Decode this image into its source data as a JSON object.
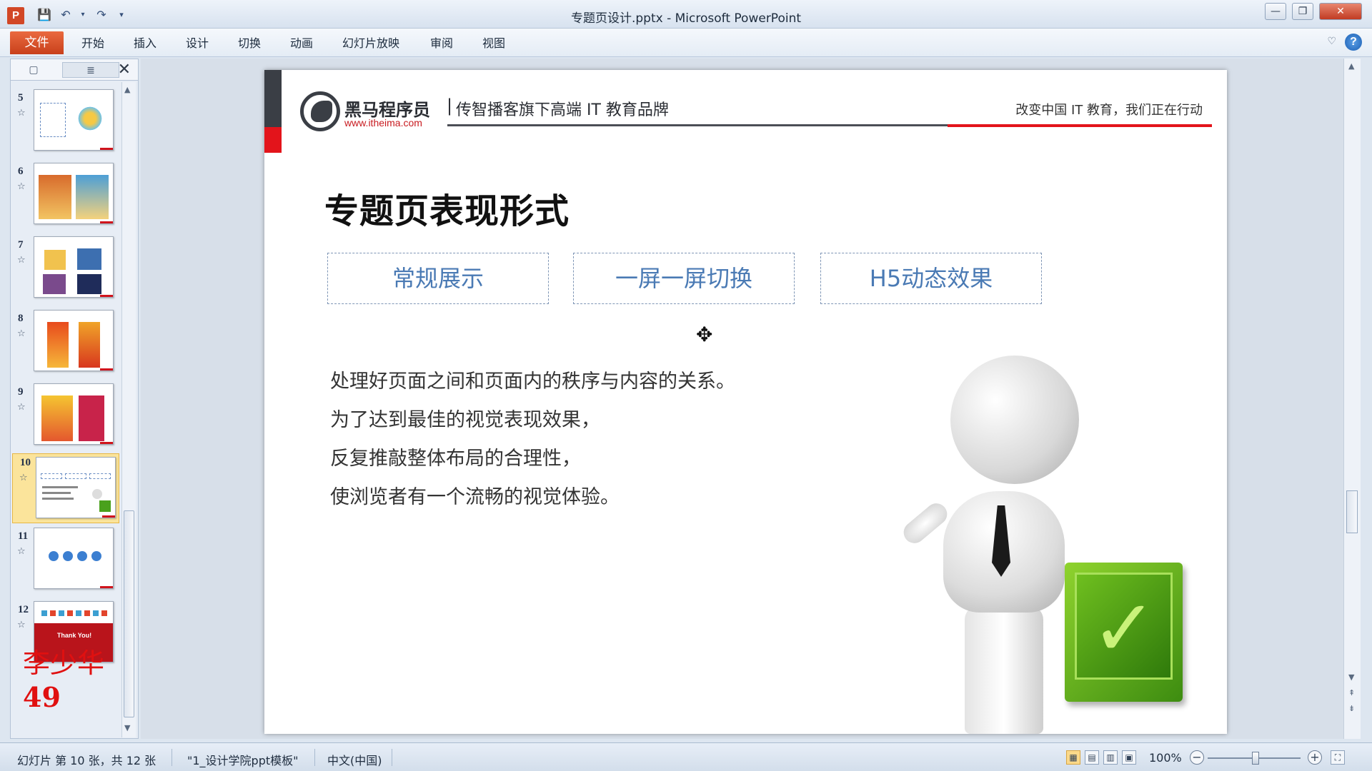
{
  "window": {
    "title": "专题页设计.pptx  -  Microsoft PowerPoint",
    "app_icon": "P"
  },
  "ribbon": {
    "file": "文件",
    "tabs": [
      "开始",
      "插入",
      "设计",
      "切换",
      "动画",
      "幻灯片放映",
      "审阅",
      "视图"
    ]
  },
  "thumbnails": [
    {
      "num": "5"
    },
    {
      "num": "6"
    },
    {
      "num": "7"
    },
    {
      "num": "8"
    },
    {
      "num": "9"
    },
    {
      "num": "10"
    },
    {
      "num": "11"
    },
    {
      "num": "12"
    }
  ],
  "thumb12_text": "Thank You!",
  "watermark": {
    "name": "李少华",
    "number": "49"
  },
  "slide": {
    "brand_name": "黑马程序员",
    "brand_url": "www.itheima.com",
    "separator": "|",
    "slogan": "传智播客旗下高端 IT 教育品牌",
    "tagline": "改变中国 IT 教育，我们正在行动",
    "title": "专题页表现形式",
    "options": [
      "常规展示",
      "一屏一屏切换",
      "H5动态效果"
    ],
    "body": [
      "处理好页面之间和页面内的秩序与内容的关系。",
      "为了达到最佳的视觉表现效果，",
      "反复推敲整体布局的合理性，",
      "使浏览者有一个流畅的视觉体验。"
    ]
  },
  "status": {
    "slide_info": "幻灯片 第 10 张，共 12 张",
    "theme": "\"1_设计学院ppt模板\"",
    "language": "中文(中国)",
    "zoom": "100%"
  }
}
